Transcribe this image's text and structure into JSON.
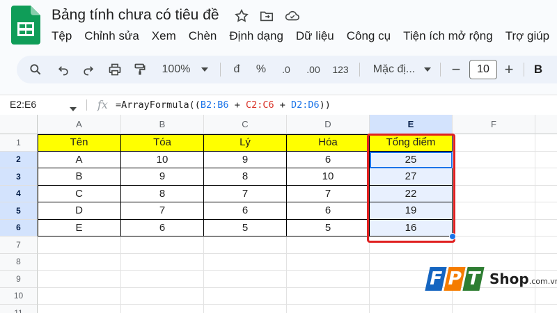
{
  "document": {
    "title": "Bảng tính chưa có tiêu đề"
  },
  "menu": [
    "Tệp",
    "Chỉnh sửa",
    "Xem",
    "Chèn",
    "Định dạng",
    "Dữ liệu",
    "Công cụ",
    "Tiện ích mở rộng",
    "Trợ giúp"
  ],
  "toolbar": {
    "zoom": "100%",
    "currency": "đ",
    "percent": "%",
    "decrease_decimal": ".0",
    "increase_decimal": ".00",
    "number_format": "123",
    "font": "Mặc đị...",
    "font_size": "10",
    "minus": "−",
    "plus": "+",
    "bold": "B"
  },
  "formula_bar": {
    "name_box": "E2:E6",
    "fx": "fx",
    "formula_prefix": "=ArrayFormula((",
    "ref1": "B2:B6",
    "op1": " + ",
    "ref2": "C2:C6",
    "op2": " + ",
    "ref3": "D2:D6",
    "formula_suffix": "))"
  },
  "sheet": {
    "columns": [
      "A",
      "B",
      "C",
      "D",
      "E",
      "F"
    ],
    "rows": [
      "1",
      "2",
      "3",
      "4",
      "5",
      "6",
      "7",
      "8",
      "9",
      "10",
      "11"
    ],
    "headers": [
      "Tên",
      "Tóa",
      "Lý",
      "Hóa",
      "Tổng điểm"
    ],
    "data": [
      [
        "A",
        "10",
        "9",
        "6",
        "25"
      ],
      [
        "B",
        "9",
        "8",
        "10",
        "27"
      ],
      [
        "C",
        "8",
        "7",
        "7",
        "22"
      ],
      [
        "D",
        "7",
        "6",
        "6",
        "19"
      ],
      [
        "E",
        "6",
        "5",
        "5",
        "16"
      ]
    ]
  },
  "branding": {
    "fpt": "FPT",
    "shop": "Shop",
    "domain": ".com.vn"
  },
  "colors": {
    "header_fill": "#ffff00",
    "selection": "#e8f0fe",
    "highlight_box": "#e02020",
    "accent": "#1a73e8"
  }
}
